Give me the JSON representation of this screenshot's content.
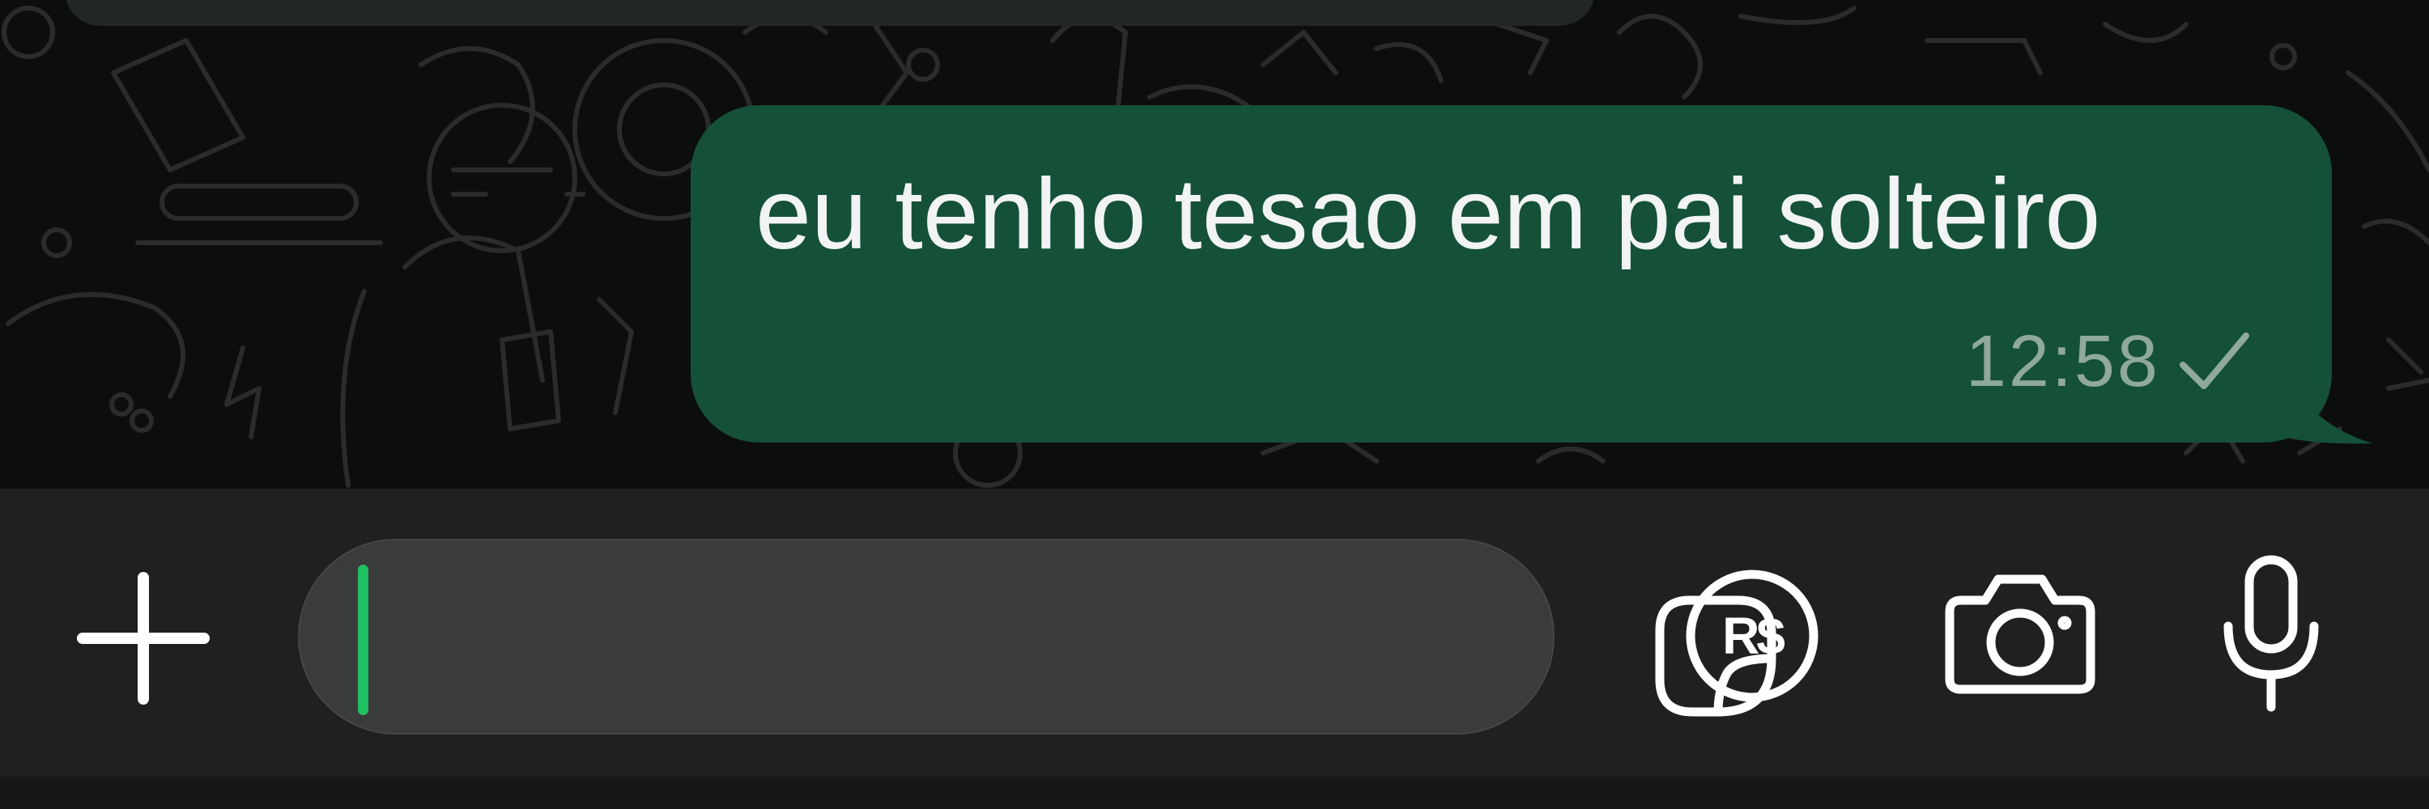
{
  "conversation": {
    "message": {
      "text": "eu tenho tesao em pai solteiro",
      "time": "12:58",
      "status_icon": "single-check-icon"
    }
  },
  "composer": {
    "input_value": "",
    "icons": {
      "attach": "plus-icon",
      "sticker": "sticker-icon",
      "payment": "payment-icon",
      "camera": "camera-icon",
      "mic": "microphone-icon"
    },
    "payment_label": "R$"
  },
  "colors": {
    "chat_background": "#0c0d0d",
    "outgoing_bubble": "#155039",
    "input_bar": "#1f2121",
    "input_field": "#3a3b3b",
    "cursor_accent": "#21c063",
    "timestamp": "#8fa99b"
  }
}
